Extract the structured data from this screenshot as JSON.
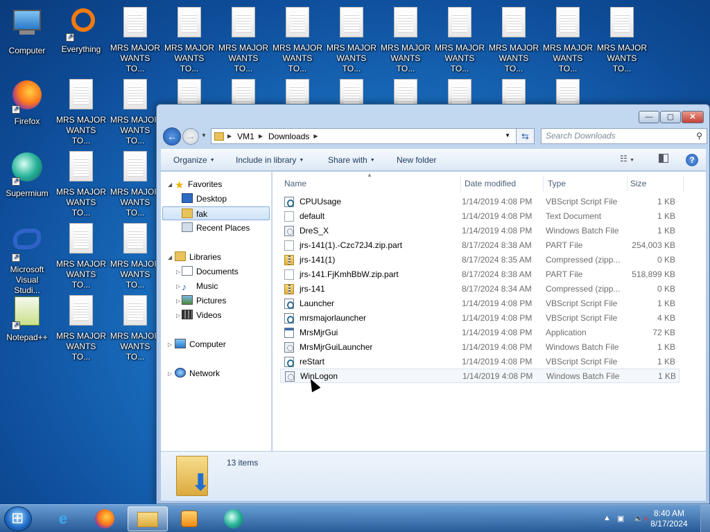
{
  "desktop": {
    "icons": {
      "computer": "Computer",
      "everything": "Everything",
      "firefox": "Firefox",
      "supermium": "Supermium",
      "visual_studio": "Microsoft Visual Studi...",
      "notepadpp": "Notepad++",
      "mrs_major_line1": "MRS MAJOR",
      "mrs_major_line2": "WANTS TO..."
    }
  },
  "window": {
    "controls": {
      "minimize": "—",
      "maximize": "▢",
      "close": "✕"
    },
    "address": {
      "root": "VM1",
      "folder": "Downloads"
    },
    "search_placeholder": "Search Downloads",
    "toolbar": {
      "organize": "Organize",
      "include_in_library": "Include in library",
      "share_with": "Share with",
      "new_folder": "New folder"
    },
    "nav": {
      "favorites": "Favorites",
      "desktop": "Desktop",
      "fak": "fak",
      "recent_places": "Recent Places",
      "libraries": "Libraries",
      "documents": "Documents",
      "music": "Music",
      "pictures": "Pictures",
      "videos": "Videos",
      "computer": "Computer",
      "network": "Network"
    },
    "columns": {
      "name": "Name",
      "date": "Date modified",
      "type": "Type",
      "size": "Size"
    },
    "files": [
      {
        "name": "CPUUsage",
        "date": "1/14/2019 4:08 PM",
        "type": "VBScript Script File",
        "size": "1 KB",
        "icon": "script"
      },
      {
        "name": "default",
        "date": "1/14/2019 4:08 PM",
        "type": "Text Document",
        "size": "1 KB",
        "icon": "txt"
      },
      {
        "name": "DreS_X",
        "date": "1/14/2019 4:08 PM",
        "type": "Windows Batch File",
        "size": "1 KB",
        "icon": "bat"
      },
      {
        "name": "jrs-141(1).-Czc72J4.zip.part",
        "date": "8/17/2024 8:38 AM",
        "type": "PART File",
        "size": "254,003 KB",
        "icon": "txt"
      },
      {
        "name": "jrs-141(1)",
        "date": "8/17/2024 8:35 AM",
        "type": "Compressed (zipp...",
        "size": "0 KB",
        "icon": "zip"
      },
      {
        "name": "jrs-141.FjKmhBbW.zip.part",
        "date": "8/17/2024 8:38 AM",
        "type": "PART File",
        "size": "518,899 KB",
        "icon": "txt"
      },
      {
        "name": "jrs-141",
        "date": "8/17/2024 8:34 AM",
        "type": "Compressed (zipp...",
        "size": "0 KB",
        "icon": "zip"
      },
      {
        "name": "Launcher",
        "date": "1/14/2019 4:08 PM",
        "type": "VBScript Script File",
        "size": "1 KB",
        "icon": "script"
      },
      {
        "name": "mrsmajorlauncher",
        "date": "1/14/2019 4:08 PM",
        "type": "VBScript Script File",
        "size": "4 KB",
        "icon": "script"
      },
      {
        "name": "MrsMjrGui",
        "date": "1/14/2019 4:08 PM",
        "type": "Application",
        "size": "72 KB",
        "icon": "app"
      },
      {
        "name": "MrsMjrGuiLauncher",
        "date": "1/14/2019 4:08 PM",
        "type": "Windows Batch File",
        "size": "1 KB",
        "icon": "bat"
      },
      {
        "name": "reStart",
        "date": "1/14/2019 4:08 PM",
        "type": "VBScript Script File",
        "size": "1 KB",
        "icon": "script"
      },
      {
        "name": "WinLogon",
        "date": "1/14/2019 4:08 PM",
        "type": "Windows Batch File",
        "size": "1 KB",
        "icon": "bat"
      }
    ],
    "status": {
      "item_count": "13 items"
    }
  },
  "taskbar": {
    "clock_time": "8:40 AM",
    "clock_date": "8/17/2024"
  },
  "colors": {
    "accent": "#1e395b",
    "selection": "#cfe3f9"
  }
}
